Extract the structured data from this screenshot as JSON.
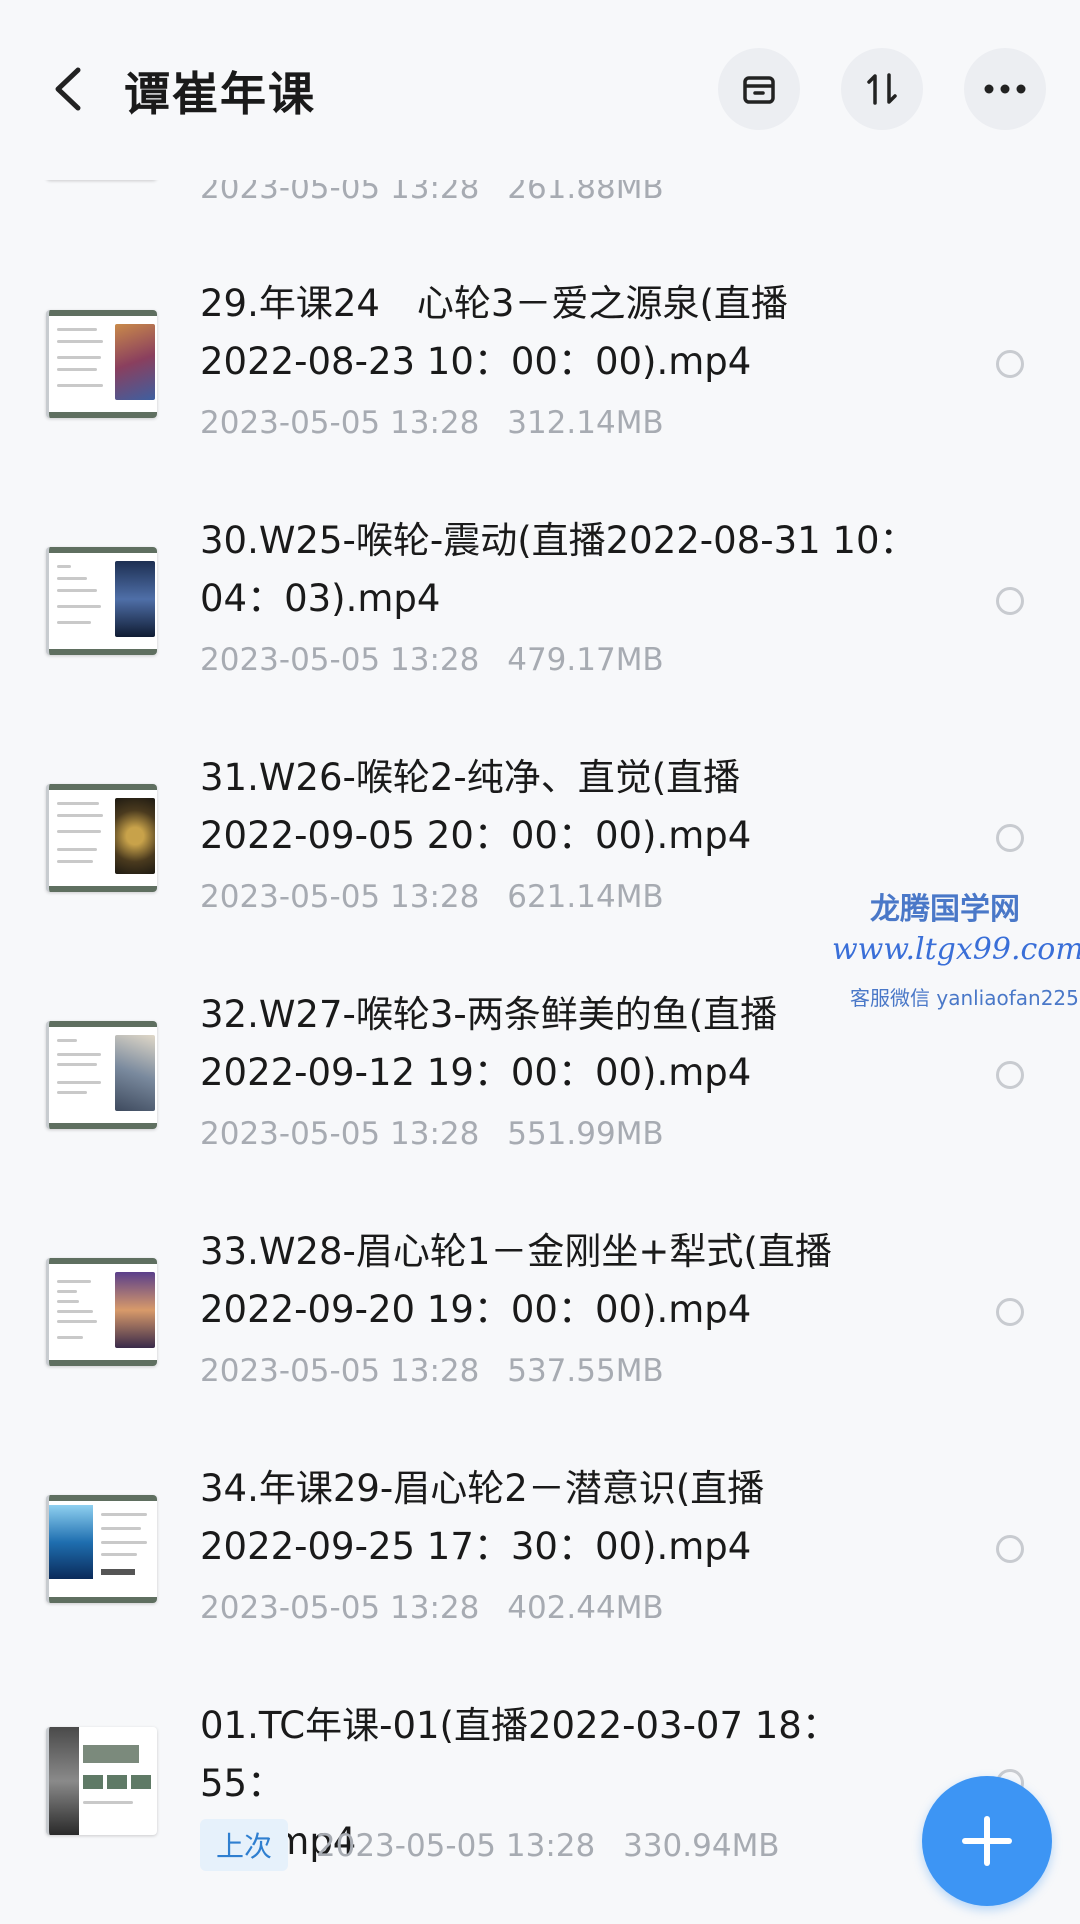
{
  "header": {
    "title": "谭崔年课",
    "icons": [
      "back-icon",
      "archive-icon",
      "sort-icon",
      "more-icon"
    ]
  },
  "partial_item": {
    "date": "2023-05-05  13:28",
    "size": "261.88MB"
  },
  "files": [
    {
      "name_line1": "29.年课24　心轮3－爱之源泉(直播",
      "name_line2": "2022-08-23 10：00：00).mp4",
      "date": "2023-05-05  13:28",
      "size": "312.14MB"
    },
    {
      "name_line1": "30.W25-喉轮-震动(直播2022-08-31 10：",
      "name_line2": "04：03).mp4",
      "date": "2023-05-05  13:28",
      "size": "479.17MB"
    },
    {
      "name_line1": "31.W26-喉轮2-纯净、直觉(直播",
      "name_line2": "2022-09-05 20：00：00).mp4",
      "date": "2023-05-05  13:28",
      "size": "621.14MB"
    },
    {
      "name_line1": "32.W27-喉轮3-两条鲜美的鱼(直播",
      "name_line2": "2022-09-12 19：00：00).mp4",
      "date": "2023-05-05  13:28",
      "size": "551.99MB"
    },
    {
      "name_line1": "33.W28-眉心轮1－金刚坐+犁式(直播",
      "name_line2": "2022-09-20 19：00：00).mp4",
      "date": "2023-05-05  13:28",
      "size": "537.55MB"
    },
    {
      "name_line1": "34.年课29-眉心轮2－潜意识(直播",
      "name_line2": "2022-09-25 17：30：00).mp4",
      "date": "2023-05-05  13:28",
      "size": "402.44MB"
    },
    {
      "name_line1": "01.TC年课-01(直播2022-03-07 18：55：",
      "name_line2": "00).mp4",
      "tag": "上次",
      "date": "2023-05-05  13:28",
      "size": "330.94MB"
    }
  ],
  "watermark": {
    "brand": "龙腾国学网",
    "url": "www.ltgx99.com",
    "contact": "客服微信 yanliaofan225"
  },
  "colors": {
    "accent": "#3d95f4",
    "background": "#f7f8fa",
    "meta_text": "#a7abb2",
    "tag_bg": "#e6f1fb",
    "tag_text": "#2f7fd0"
  }
}
